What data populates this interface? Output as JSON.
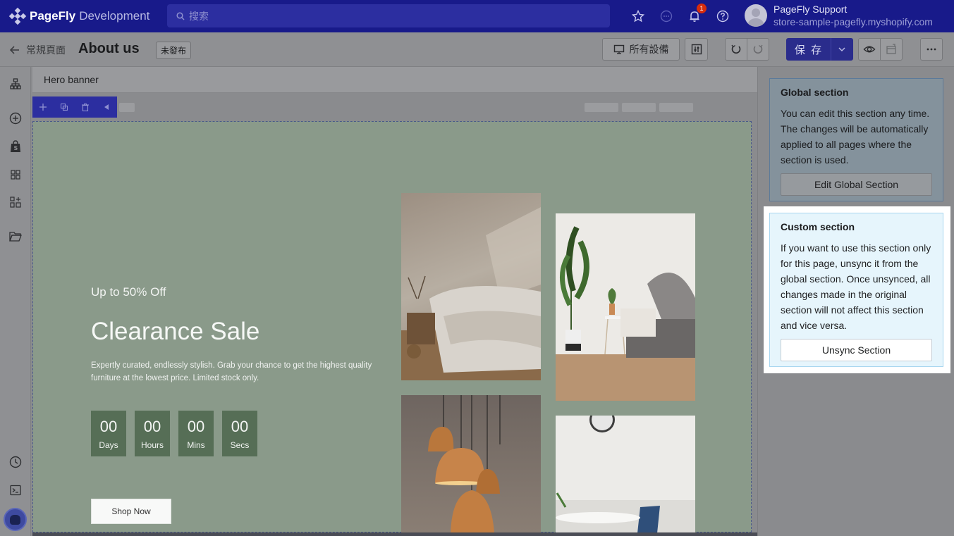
{
  "app": {
    "brand": "PageFly",
    "environment": "Development",
    "search_placeholder": "搜索",
    "notification_count": "1",
    "user_name": "PageFly Support",
    "user_store": "store-sample-pagefly.myshopify.com"
  },
  "toolbar": {
    "back_label": "常規頁面",
    "page_title": "About us",
    "status_badge": "未發布",
    "device_label": "所有設備",
    "save_label": "保 存"
  },
  "canvas": {
    "breadcrumb": "Hero banner",
    "hero": {
      "subtitle": "Up to 50% Off",
      "title": "Clearance Sale",
      "description": "Expertly curated, endlessly stylish. Grab your chance to get the highest quality furniture at the lowest price. Limited stock only.",
      "countdown": [
        {
          "value": "00",
          "label": "Days"
        },
        {
          "value": "00",
          "label": "Hours"
        },
        {
          "value": "00",
          "label": "Mins"
        },
        {
          "value": "00",
          "label": "Secs"
        }
      ],
      "cta_label": "Shop Now"
    }
  },
  "panel": {
    "global": {
      "title": "Global section",
      "body": "You can edit this section any time. The changes will be automatically applied to all pages where the section is used.",
      "button": "Edit Global Section"
    },
    "custom": {
      "title": "Custom section",
      "body": "If you want to use this section only for this page, unsync it from the global section. Once unsynced, all changes made in the original section will not affect this section and vice versa.",
      "button": "Unsync Section"
    }
  },
  "colors": {
    "topbar": "#181a8a",
    "primary": "#2a2c8c",
    "hero_bg": "#8a9a8a",
    "countdown_box": "#566e56",
    "custom_card_bg": "#e6f5fc"
  }
}
